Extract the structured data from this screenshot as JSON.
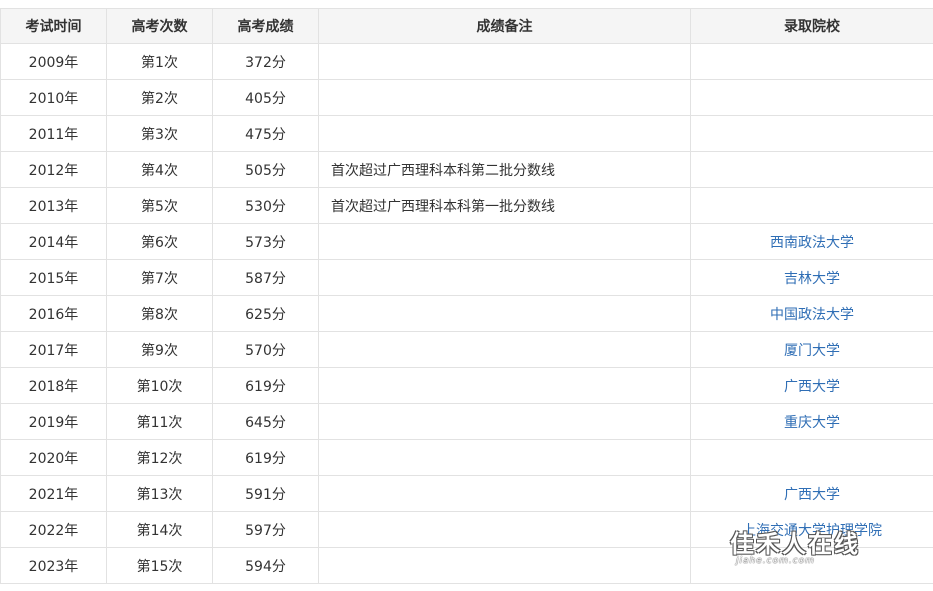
{
  "table": {
    "headers": [
      "考试时间",
      "高考次数",
      "高考成绩",
      "成绩备注",
      "录取院校"
    ],
    "rows": [
      {
        "year": "2009年",
        "attempt": "第1次",
        "score": "372分",
        "note": "",
        "school": ""
      },
      {
        "year": "2010年",
        "attempt": "第2次",
        "score": "405分",
        "note": "",
        "school": ""
      },
      {
        "year": "2011年",
        "attempt": "第3次",
        "score": "475分",
        "note": "",
        "school": ""
      },
      {
        "year": "2012年",
        "attempt": "第4次",
        "score": "505分",
        "note": "首次超过广西理科本科第二批分数线",
        "school": ""
      },
      {
        "year": "2013年",
        "attempt": "第5次",
        "score": "530分",
        "note": "首次超过广西理科本科第一批分数线",
        "school": ""
      },
      {
        "year": "2014年",
        "attempt": "第6次",
        "score": "573分",
        "note": "",
        "school": "西南政法大学"
      },
      {
        "year": "2015年",
        "attempt": "第7次",
        "score": "587分",
        "note": "",
        "school": "吉林大学"
      },
      {
        "year": "2016年",
        "attempt": "第8次",
        "score": "625分",
        "note": "",
        "school": "中国政法大学"
      },
      {
        "year": "2017年",
        "attempt": "第9次",
        "score": "570分",
        "note": "",
        "school": "厦门大学"
      },
      {
        "year": "2018年",
        "attempt": "第10次",
        "score": "619分",
        "note": "",
        "school": "广西大学"
      },
      {
        "year": "2019年",
        "attempt": "第11次",
        "score": "645分",
        "note": "",
        "school": "重庆大学"
      },
      {
        "year": "2020年",
        "attempt": "第12次",
        "score": "619分",
        "note": "",
        "school": ""
      },
      {
        "year": "2021年",
        "attempt": "第13次",
        "score": "591分",
        "note": "",
        "school": "广西大学"
      },
      {
        "year": "2022年",
        "attempt": "第14次",
        "score": "597分",
        "note": "",
        "school": "上海交通大学护理学院"
      },
      {
        "year": "2023年",
        "attempt": "第15次",
        "score": "594分",
        "note": "",
        "school": ""
      }
    ]
  },
  "watermark": {
    "text": "佳禾人在线",
    "sub": "jiahe.com.com"
  },
  "colors": {
    "link": "#2f6eb5",
    "header_bg": "#f5f5f5",
    "border": "#e2e2e2"
  }
}
